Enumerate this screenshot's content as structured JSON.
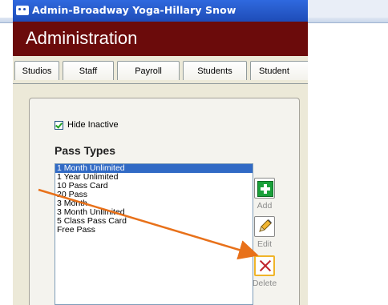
{
  "window": {
    "title": "Admin-Broadway Yoga-Hillary Snow"
  },
  "header": {
    "title": "Administration"
  },
  "tabs": [
    {
      "label": "Studios"
    },
    {
      "label": "Staff"
    },
    {
      "label": "Payroll"
    },
    {
      "label": "Students"
    },
    {
      "label": "Student"
    }
  ],
  "filters": {
    "hide_inactive_label": "Hide Inactive",
    "hide_inactive_checked": true
  },
  "pass_types": {
    "title": "Pass Types",
    "items": [
      "1 Month Unlimited",
      "1 Year Unlimited",
      "10 Pass Card",
      "20 Pass",
      "3 Month",
      "3 Month Unlimited",
      "5 Class Pass Card",
      "Free Pass"
    ],
    "selected_index": 0
  },
  "actions": {
    "add_label": "Add",
    "edit_label": "Edit",
    "delete_label": "Delete"
  },
  "colors": {
    "header_bg": "#6b0b0b",
    "titlebar_bg": "#2a5fd0",
    "selection": "#316ac5",
    "annotation_arrow": "#e8711a",
    "highlight_border": "#f0b429"
  },
  "icons": {
    "window_icon": "yoga-app-icon",
    "checkbox": "checkmark-icon",
    "add": "plus-icon",
    "edit": "pencil-icon",
    "delete": "x-icon"
  }
}
